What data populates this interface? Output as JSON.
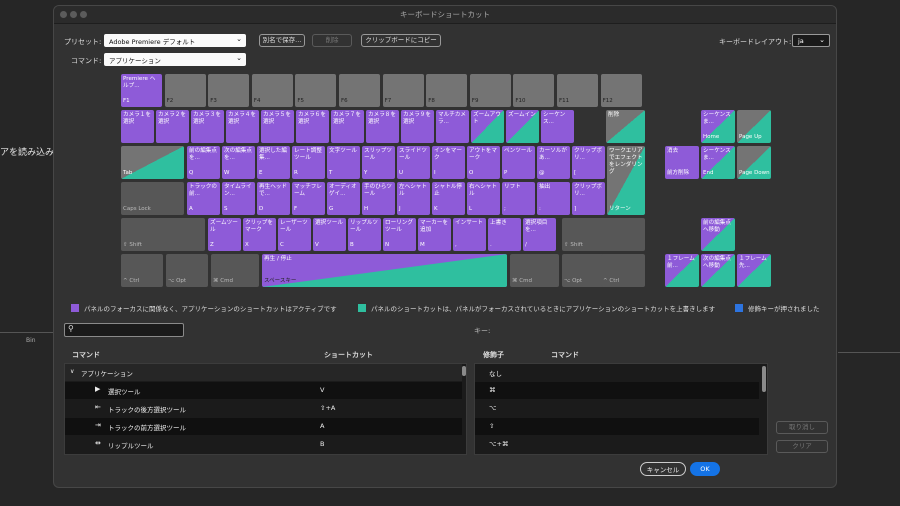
{
  "background": {
    "left_text": "アを読み込みし",
    "left_small": "Bin"
  },
  "dialog": {
    "title": "キーボードショートカット",
    "preset_label": "プリセット:",
    "preset_value": "Adobe Premiere デフォルト",
    "save_as": "別名で保存...",
    "delete": "削除",
    "copy_clipboard": "クリップボードにコピー",
    "layout_label": "キーボードレイアウト:",
    "layout_value": "ja",
    "command_label": "コマンド:",
    "command_value": "アプリケーション"
  },
  "keyboard": {
    "row_fn": [
      {
        "label": "Premiere ヘルプ...",
        "fk": "F1",
        "color": "p"
      },
      {
        "label": "",
        "fk": "F2",
        "color": "n"
      },
      {
        "label": "",
        "fk": "F3",
        "color": "n"
      },
      {
        "label": "",
        "fk": "F4",
        "color": "n"
      },
      {
        "label": "",
        "fk": "F5",
        "color": "n"
      },
      {
        "label": "",
        "fk": "F6",
        "color": "n"
      },
      {
        "label": "",
        "fk": "F7",
        "color": "n"
      },
      {
        "label": "",
        "fk": "F8",
        "color": "n"
      },
      {
        "label": "",
        "fk": "F9",
        "color": "n"
      },
      {
        "label": "",
        "fk": "F10",
        "color": "n"
      },
      {
        "label": "",
        "fk": "F11",
        "color": "n"
      },
      {
        "label": "",
        "fk": "F12",
        "color": "n"
      }
    ],
    "row_num": [
      {
        "label": "カメラ１を選択",
        "fk": "",
        "color": "p"
      },
      {
        "label": "カメラ２を選択",
        "fk": "",
        "color": "p"
      },
      {
        "label": "カメラ３を選択",
        "fk": "",
        "color": "p"
      },
      {
        "label": "カメラ４を選択",
        "fk": "",
        "color": "p"
      },
      {
        "label": "カメラ５を選択",
        "fk": "",
        "color": "p"
      },
      {
        "label": "カメラ６を選択",
        "fk": "",
        "color": "p"
      },
      {
        "label": "カメラ７を選択",
        "fk": "",
        "color": "p"
      },
      {
        "label": "カメラ８を選択",
        "fk": "",
        "color": "p"
      },
      {
        "label": "カメラ９を選択",
        "fk": "",
        "color": "p"
      },
      {
        "label": "マルチカメラ...",
        "fk": "",
        "color": "p"
      },
      {
        "label": "ズームアウト",
        "fk": "",
        "color": "pg"
      },
      {
        "label": "ズームイン",
        "fk": "",
        "color": "pg"
      },
      {
        "label": "シーケンス...",
        "fk": "",
        "color": "p"
      },
      {
        "label": "削除",
        "fk": "",
        "color": "gg"
      }
    ],
    "row_q": [
      {
        "label": "",
        "fk": "Tab",
        "color": "gg"
      },
      {
        "label": "前の編集点を...",
        "fk": "Q",
        "color": "p"
      },
      {
        "label": "次の編集点を...",
        "fk": "W",
        "color": "p"
      },
      {
        "label": "選択した編集...",
        "fk": "E",
        "color": "p"
      },
      {
        "label": "レート調整ツール",
        "fk": "R",
        "color": "p"
      },
      {
        "label": "文字ツール",
        "fk": "T",
        "color": "p"
      },
      {
        "label": "スリップツール",
        "fk": "Y",
        "color": "p"
      },
      {
        "label": "スライドツール",
        "fk": "U",
        "color": "p"
      },
      {
        "label": "インをマーク",
        "fk": "I",
        "color": "p"
      },
      {
        "label": "アウトをマーク",
        "fk": "O",
        "color": "p"
      },
      {
        "label": "ペンツール",
        "fk": "P",
        "color": "p"
      },
      {
        "label": "カーソルがあ...",
        "fk": "@",
        "color": "p"
      },
      {
        "label": "クリップボリ...",
        "fk": "[",
        "color": "p"
      }
    ],
    "enter_key": {
      "label": "ワークエリアでエフェクトをレンダリング",
      "fk": "リターン"
    },
    "row_a": [
      {
        "label": "",
        "fk": "Caps Lock",
        "color": "d"
      },
      {
        "label": "トラックの前...",
        "fk": "A",
        "color": "p"
      },
      {
        "label": "タイムライン...",
        "fk": "S",
        "color": "p"
      },
      {
        "label": "再生ヘッドで...",
        "fk": "D",
        "color": "p"
      },
      {
        "label": "マッチフレーム",
        "fk": "F",
        "color": "p"
      },
      {
        "label": "オーディオゲイ...",
        "fk": "G",
        "color": "p"
      },
      {
        "label": "手のひらツール",
        "fk": "H",
        "color": "p"
      },
      {
        "label": "左へシャトル",
        "fk": "J",
        "color": "p"
      },
      {
        "label": "シャトル停止",
        "fk": "K",
        "color": "p"
      },
      {
        "label": "右へシャトル",
        "fk": "L",
        "color": "p"
      },
      {
        "label": "リフト",
        "fk": ";",
        "color": "p"
      },
      {
        "label": "抽出",
        "fk": ":",
        "color": "p"
      },
      {
        "label": "クリップボリ...",
        "fk": "]",
        "color": "p"
      }
    ],
    "row_z": [
      {
        "label": "",
        "fk": "⇧ Shift",
        "color": "d"
      },
      {
        "label": "ズームツール",
        "fk": "Z",
        "color": "p"
      },
      {
        "label": "クリップをマーク",
        "fk": "X",
        "color": "p"
      },
      {
        "label": "レーザーツール",
        "fk": "C",
        "color": "p"
      },
      {
        "label": "選択ツール",
        "fk": "V",
        "color": "p"
      },
      {
        "label": "リップルツール",
        "fk": "B",
        "color": "p"
      },
      {
        "label": "ローリングツール",
        "fk": "N",
        "color": "p"
      },
      {
        "label": "マーカーを追加",
        "fk": "M",
        "color": "p"
      },
      {
        "label": "インサート",
        "fk": ",",
        "color": "p"
      },
      {
        "label": "上書き",
        "fk": ".",
        "color": "p"
      },
      {
        "label": "選択項目を...",
        "fk": "/",
        "color": "p"
      },
      {
        "label": "",
        "fk": "⇧ Shift",
        "color": "d"
      }
    ],
    "row_bottom": [
      {
        "label": "",
        "fk": "^ Ctrl",
        "color": "d"
      },
      {
        "label": "",
        "fk": "⌥ Opt",
        "color": "d"
      },
      {
        "label": "",
        "fk": "⌘ Cmd",
        "color": "d"
      },
      {
        "label": "再生 / 停止",
        "fk": "スペースキー",
        "color": "space"
      },
      {
        "label": "",
        "fk": "⌘ Cmd",
        "color": "d"
      },
      {
        "label": "",
        "fk": "⌥ Opt",
        "color": "d"
      },
      {
        "label": "",
        "fk": "^ Ctrl",
        "color": "d"
      }
    ],
    "nav_top": [
      {
        "label": "シーケンスま...",
        "fk": "Home",
        "color": "pg"
      },
      {
        "label": "",
        "fk": "Page Up",
        "color": "gg"
      }
    ],
    "nav_mid": [
      {
        "label": "消去",
        "fk": "前方削除",
        "color": "p"
      },
      {
        "label": "シーケンスま...",
        "fk": "End",
        "color": "pg"
      },
      {
        "label": "",
        "fk": "Page Down",
        "color": "gg"
      }
    ],
    "arrow_up": {
      "label": "前の編集点へ移動",
      "fk": "",
      "color": "pg"
    },
    "arrows": [
      {
        "label": "１フレーム前...",
        "fk": "",
        "color": "pg"
      },
      {
        "label": "次の編集点へ移動",
        "fk": "",
        "color": "pg"
      },
      {
        "label": "１フレーム先...",
        "fk": "",
        "color": "pg"
      }
    ]
  },
  "legend": {
    "purple_text": "パネルのフォーカスに関係なく、アプリケーションのショートカットはアクティブです",
    "green_text": "パネルのショートカットは、パネルがフォーカスされているときにアプリケーションのショートカットを上書きします",
    "blue_text": "修飾キーが押されました",
    "purple": "#8e5bd8",
    "green": "#2fbf9f",
    "blue": "#2d74e0"
  },
  "search": {
    "placeholder": ""
  },
  "key_label": "キー:",
  "list": {
    "col_command": "コマンド",
    "col_shortcut": "ショートカット",
    "group": "アプリケーション",
    "rows": [
      {
        "icon": "▶",
        "name": "選択ツール",
        "shortcut": "V"
      },
      {
        "icon": "⇤",
        "name": "トラックの後方選択ツール",
        "shortcut": "⇧+A"
      },
      {
        "icon": "⇥",
        "name": "トラックの前方選択ツール",
        "shortcut": "A"
      },
      {
        "icon": "⇹",
        "name": "リップルツール",
        "shortcut": "B"
      }
    ]
  },
  "modifiers": {
    "col_modifier": "修飾子",
    "col_command": "コマンド",
    "rows": [
      {
        "mod": "なし",
        "cmd": ""
      },
      {
        "mod": "⌘",
        "cmd": ""
      },
      {
        "mod": "⌥",
        "cmd": ""
      },
      {
        "mod": "⇧",
        "cmd": ""
      },
      {
        "mod": "⌥+⌘",
        "cmd": ""
      }
    ]
  },
  "buttons": {
    "undo": "取り消し",
    "clear": "クリア",
    "cancel": "キャンセル",
    "ok": "OK"
  }
}
